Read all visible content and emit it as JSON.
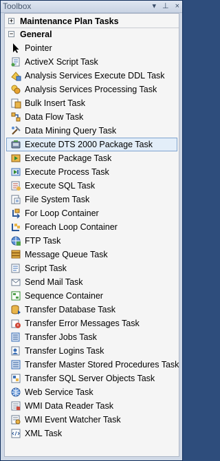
{
  "window": {
    "title": "Toolbox",
    "controls": [
      "▾",
      "⊥",
      "×"
    ]
  },
  "groups": [
    {
      "label": "Maintenance Plan Tasks",
      "expander": "+"
    },
    {
      "label": "General",
      "expander": "−"
    }
  ],
  "items": [
    {
      "label": "Pointer",
      "icon": "pointer-icon"
    },
    {
      "label": "ActiveX Script Task",
      "icon": "activex-script-icon"
    },
    {
      "label": "Analysis Services Execute DDL Task",
      "icon": "analysis-ddl-icon"
    },
    {
      "label": "Analysis Services Processing Task",
      "icon": "analysis-processing-icon"
    },
    {
      "label": "Bulk Insert Task",
      "icon": "bulk-insert-icon"
    },
    {
      "label": "Data Flow Task",
      "icon": "data-flow-icon"
    },
    {
      "label": "Data Mining Query Task",
      "icon": "data-mining-icon"
    },
    {
      "label": "Execute DTS 2000 Package Task",
      "icon": "dts-package-icon",
      "selected": true
    },
    {
      "label": "Execute Package Task",
      "icon": "execute-package-icon"
    },
    {
      "label": "Execute Process Task",
      "icon": "execute-process-icon"
    },
    {
      "label": "Execute SQL Task",
      "icon": "execute-sql-icon"
    },
    {
      "label": "File System Task",
      "icon": "file-system-icon"
    },
    {
      "label": "For Loop Container",
      "icon": "for-loop-icon"
    },
    {
      "label": "Foreach Loop Container",
      "icon": "foreach-loop-icon"
    },
    {
      "label": "FTP Task",
      "icon": "ftp-icon"
    },
    {
      "label": "Message Queue Task",
      "icon": "message-queue-icon"
    },
    {
      "label": "Script Task",
      "icon": "script-icon"
    },
    {
      "label": "Send Mail Task",
      "icon": "send-mail-icon"
    },
    {
      "label": "Sequence Container",
      "icon": "sequence-icon"
    },
    {
      "label": "Transfer Database Task",
      "icon": "transfer-database-icon"
    },
    {
      "label": "Transfer Error Messages Task",
      "icon": "transfer-error-icon"
    },
    {
      "label": "Transfer Jobs Task",
      "icon": "transfer-jobs-icon"
    },
    {
      "label": "Transfer Logins Task",
      "icon": "transfer-logins-icon"
    },
    {
      "label": "Transfer Master Stored Procedures Task",
      "icon": "transfer-procs-icon"
    },
    {
      "label": "Transfer SQL Server Objects Task",
      "icon": "transfer-objects-icon"
    },
    {
      "label": "Web Service Task",
      "icon": "web-service-icon"
    },
    {
      "label": "WMI Data Reader Task",
      "icon": "wmi-reader-icon"
    },
    {
      "label": "WMI Event Watcher Task",
      "icon": "wmi-watcher-icon"
    },
    {
      "label": "XML Task",
      "icon": "xml-icon"
    }
  ],
  "colors": {
    "selection_bg": "#e3eef9",
    "selection_border": "#7da2ce",
    "frame": "#2e4d7c"
  }
}
